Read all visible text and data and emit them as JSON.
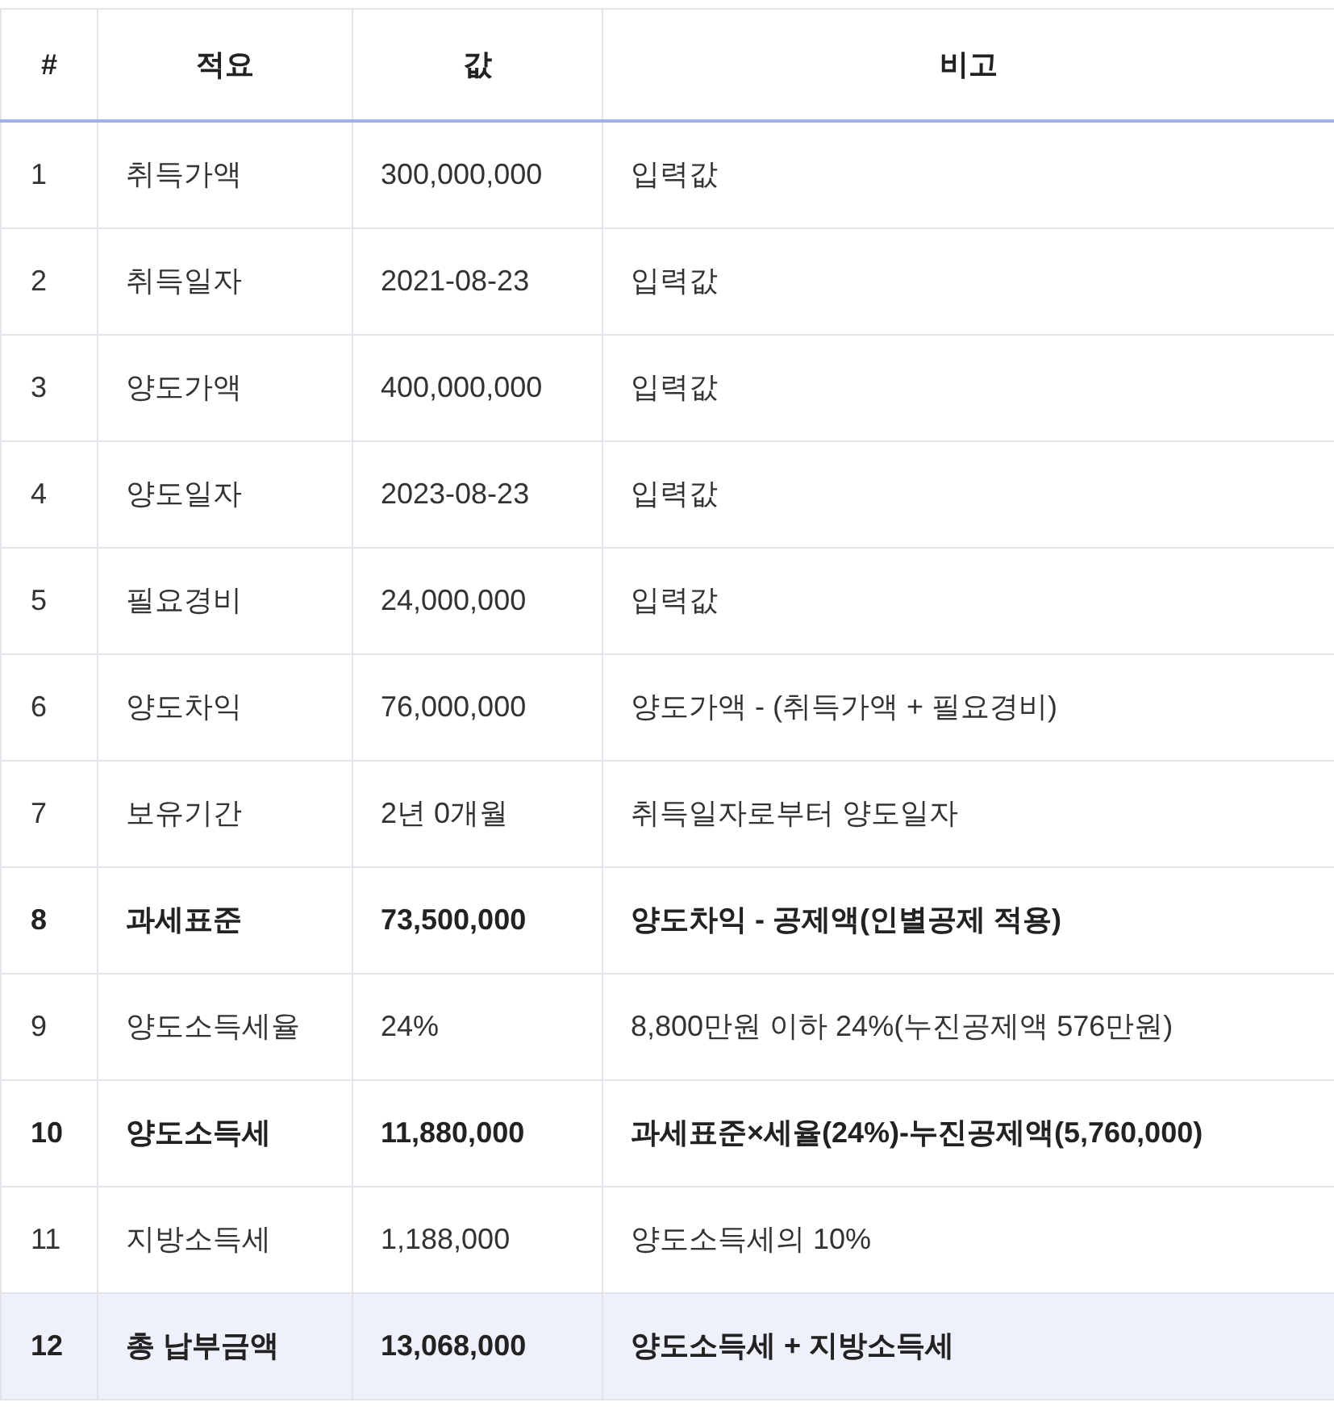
{
  "table": {
    "columns": [
      "#",
      "적요",
      "값",
      "비고"
    ],
    "rows": [
      {
        "no": "1",
        "label": "취득가액",
        "value": "300,000,000",
        "note": "입력값",
        "bold": false,
        "highlighted": false
      },
      {
        "no": "2",
        "label": "취득일자",
        "value": "2021-08-23",
        "note": "입력값",
        "bold": false,
        "highlighted": false
      },
      {
        "no": "3",
        "label": "양도가액",
        "value": "400,000,000",
        "note": "입력값",
        "bold": false,
        "highlighted": false
      },
      {
        "no": "4",
        "label": "양도일자",
        "value": "2023-08-23",
        "note": "입력값",
        "bold": false,
        "highlighted": false
      },
      {
        "no": "5",
        "label": "필요경비",
        "value": "24,000,000",
        "note": "입력값",
        "bold": false,
        "highlighted": false
      },
      {
        "no": "6",
        "label": "양도차익",
        "value": "76,000,000",
        "note": "양도가액 - (취득가액 + 필요경비)",
        "bold": false,
        "highlighted": false
      },
      {
        "no": "7",
        "label": "보유기간",
        "value": "2년 0개월",
        "note": "취득일자로부터 양도일자",
        "bold": false,
        "highlighted": false
      },
      {
        "no": "8",
        "label": "과세표준",
        "value": "73,500,000",
        "note": "양도차익 - 공제액(인별공제 적용)",
        "bold": true,
        "highlighted": false
      },
      {
        "no": "9",
        "label": "양도소득세율",
        "value": "24%",
        "note": "8,800만원 이하 24%(누진공제액 576만원)",
        "bold": false,
        "highlighted": false
      },
      {
        "no": "10",
        "label": "양도소득세",
        "value": "11,880,000",
        "note": "과세표준×세율(24%)-누진공제액(5,760,000)",
        "bold": true,
        "highlighted": false
      },
      {
        "no": "11",
        "label": "지방소득세",
        "value": "1,188,000",
        "note": "양도소득세의 10%",
        "bold": false,
        "highlighted": false
      },
      {
        "no": "12",
        "label": "총 납부금액",
        "value": "13,068,000",
        "note": "양도소득세 + 지방소득세",
        "bold": true,
        "highlighted": true
      }
    ]
  }
}
